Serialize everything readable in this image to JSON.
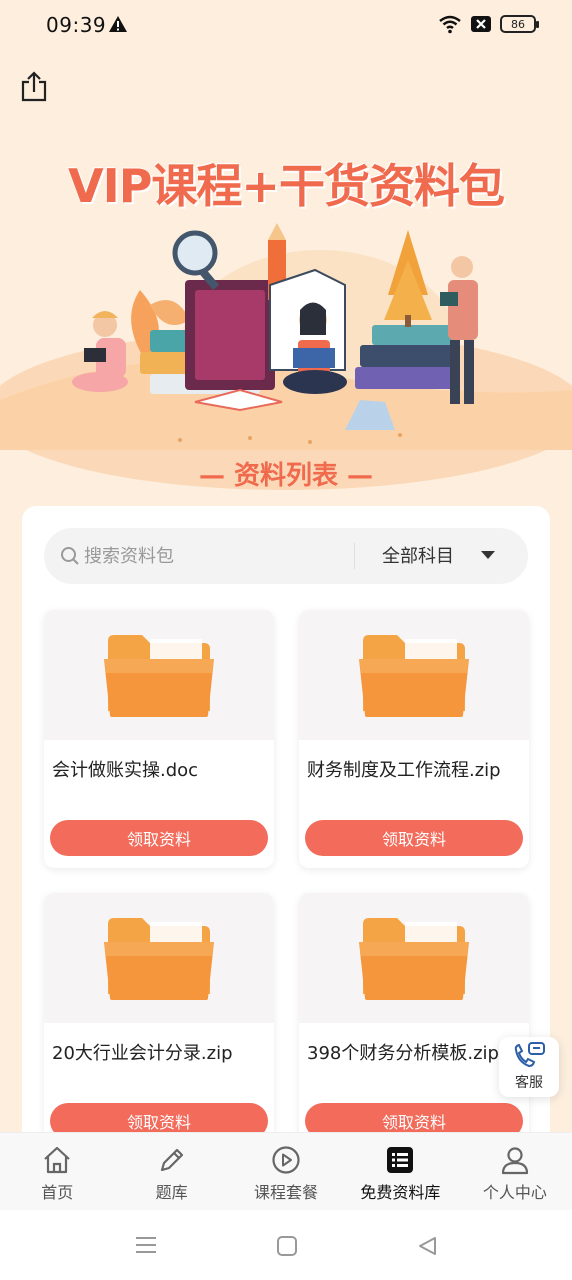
{
  "status": {
    "time": "09:39",
    "battery": "86"
  },
  "hero": {
    "title": "VIP课程+干货资料包",
    "section_label": "— 资料列表 —"
  },
  "search": {
    "placeholder": "搜索资料包",
    "subject": "全部科目"
  },
  "items": [
    {
      "name": "会计做账实操.doc",
      "button": "领取资料"
    },
    {
      "name": "财务制度及工作流程.zip",
      "button": "领取资料"
    },
    {
      "name": "20大行业会计分录.zip",
      "button": "领取资料"
    },
    {
      "name": "398个财务分析模板.zip",
      "button": "领取资料"
    }
  ],
  "service": {
    "label": "客服"
  },
  "tabs": [
    {
      "label": "首页",
      "icon": "home-icon"
    },
    {
      "label": "题库",
      "icon": "pencil-icon"
    },
    {
      "label": "课程套餐",
      "icon": "play-icon"
    },
    {
      "label": "免费资料库",
      "icon": "list-icon"
    },
    {
      "label": "个人中心",
      "icon": "user-icon"
    }
  ],
  "colors": {
    "accent": "#f26b5b",
    "background": "#fdeede",
    "title": "#f06a4e"
  }
}
